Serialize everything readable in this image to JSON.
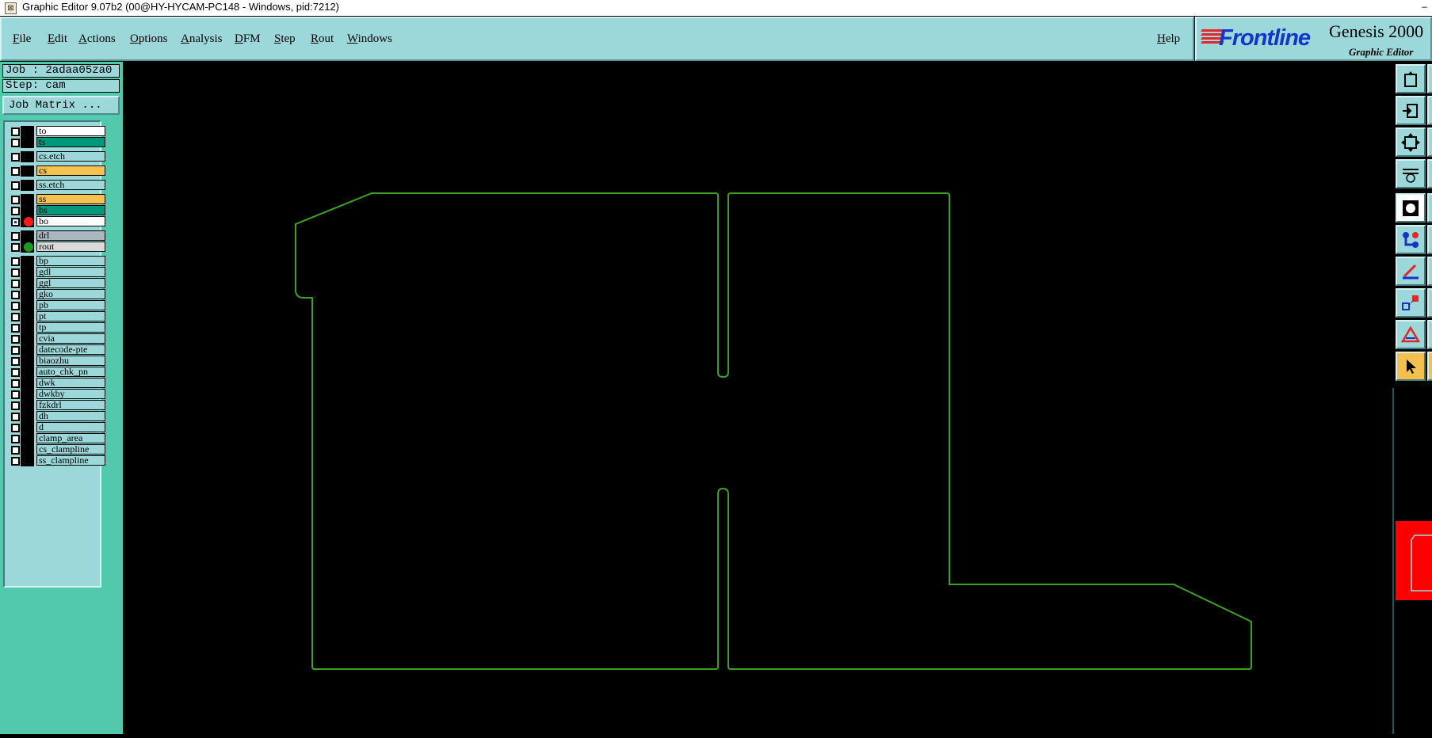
{
  "window": {
    "title": "Graphic Editor 9.07b2 (00@HY-HYCAM-PC148 - Windows, pid:7212)",
    "min_glyph": "–"
  },
  "menubar": {
    "items": [
      "File",
      "Edit",
      "Actions",
      "Options",
      "Analysis",
      "DFM",
      "Step",
      "Rout",
      "Windows"
    ],
    "help": "Help"
  },
  "brand": {
    "logo": "Frontline",
    "product": "Genesis 2000",
    "subtitle": "Graphic Editor"
  },
  "job_info": {
    "job": "Job : 2adaa05za0",
    "step": "Step: cam",
    "job_matrix_button": "Job Matrix ..."
  },
  "layers": [
    {
      "name": "to",
      "color": "#ffffff",
      "top": true
    },
    {
      "name": "ts",
      "color": "#00987a"
    },
    {
      "name": "cs.etch",
      "color": "#9cd8da"
    },
    {
      "name": "cs",
      "color": "#f6c24f"
    },
    {
      "name": "ss.etch",
      "color": "#9cd8da"
    },
    {
      "name": "ss",
      "color": "#f6c24f"
    },
    {
      "name": "bs",
      "color": "#00987a"
    },
    {
      "name": "bo",
      "color": "#ffffff",
      "active": true,
      "indicator": "#ff1a1a"
    },
    {
      "name": "drl",
      "color": "#a9b6bf"
    },
    {
      "name": "rout",
      "color": "#d9dadb",
      "indicator": "#1f9a1f"
    },
    {
      "name": "bp",
      "color": "#9cd8da"
    },
    {
      "name": "gdl",
      "color": "#9cd8da"
    },
    {
      "name": "ggl",
      "color": "#9cd8da"
    },
    {
      "name": "gko",
      "color": "#9cd8da"
    },
    {
      "name": "pb",
      "color": "#9cd8da"
    },
    {
      "name": "pt",
      "color": "#9cd8da"
    },
    {
      "name": "tp",
      "color": "#9cd8da"
    },
    {
      "name": "cvia",
      "color": "#9cd8da"
    },
    {
      "name": "datecode-pte",
      "color": "#9cd8da"
    },
    {
      "name": "biaozhu",
      "color": "#9cd8da"
    },
    {
      "name": "auto_chk_pn",
      "color": "#9cd8da"
    },
    {
      "name": "dwk",
      "color": "#9cd8da"
    },
    {
      "name": "dwkby",
      "color": "#9cd8da"
    },
    {
      "name": "fzkdrl",
      "color": "#9cd8da"
    },
    {
      "name": "dh",
      "color": "#9cd8da"
    },
    {
      "name": "d",
      "color": "#9cd8da"
    },
    {
      "name": "clamp_area",
      "color": "#9cd8da"
    },
    {
      "name": "cs_clampline",
      "color": "#9cd8da"
    },
    {
      "name": "ss_clampline",
      "color": "#9cd8da"
    }
  ],
  "toolbar": {
    "buttons": [
      "undo-icon",
      "input-icon",
      "zoom-fit-icon",
      "measure-icon",
      "snap-icon",
      "connect-icon",
      "angle-icon",
      "point-icon",
      "warning-icon",
      "pointer-icon"
    ],
    "selected": "pointer-icon"
  },
  "colors": {
    "panel": "#9cd8da",
    "sidebar": "#52c8ad",
    "outline": "#3aa21e",
    "canvas": "#000000"
  }
}
